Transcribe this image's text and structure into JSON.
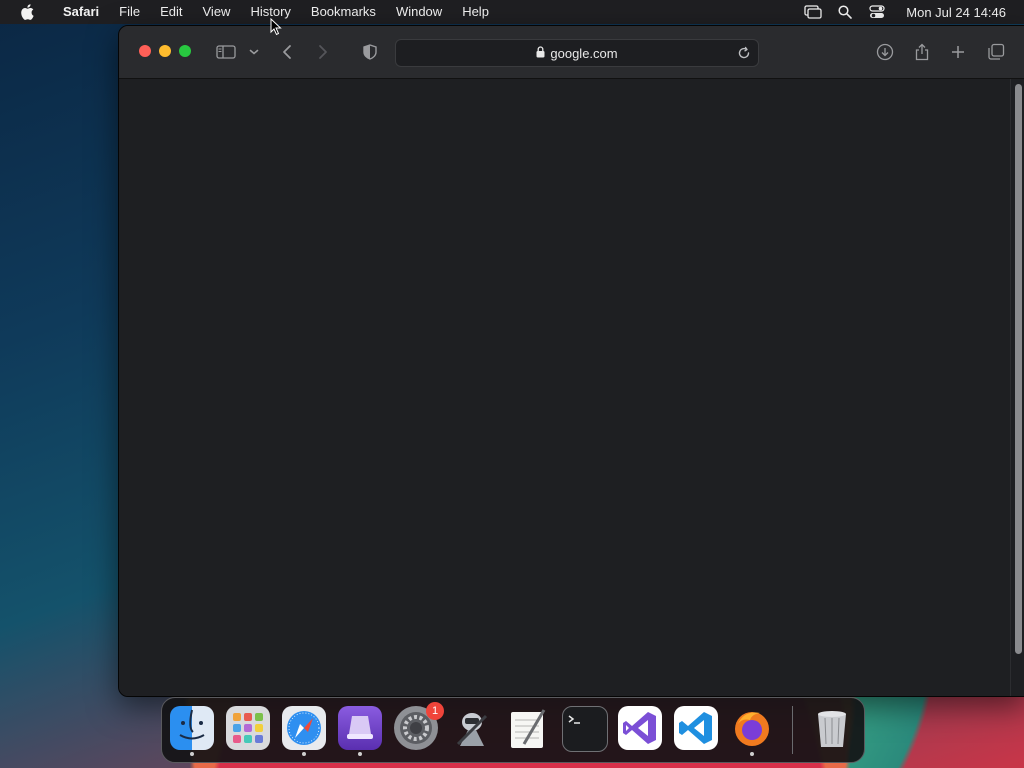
{
  "menubar": {
    "app_name": "Safari",
    "items": [
      "File",
      "Edit",
      "View",
      "History",
      "Bookmarks",
      "Window",
      "Help"
    ],
    "clock": "Mon Jul 24  14:46",
    "status_icons": [
      "screen-mirroring-icon",
      "spotlight-search-icon",
      "control-center-icon"
    ]
  },
  "browser": {
    "url": "google.com",
    "toolbar_icons": [
      "sidebar-icon",
      "chevron-down-icon",
      "back-icon",
      "forward-icon",
      "privacy-shield-icon",
      "lock-icon",
      "reload-icon",
      "download-icon",
      "share-icon",
      "new-tab-icon",
      "tab-overview-icon"
    ]
  },
  "dock": {
    "apps": [
      {
        "name": "Finder",
        "running": true
      },
      {
        "name": "Launchpad",
        "running": false
      },
      {
        "name": "Safari",
        "running": true
      },
      {
        "name": "Simulator",
        "running": true
      },
      {
        "name": "System Settings",
        "running": false,
        "badge": "1"
      },
      {
        "name": "Automator",
        "running": false
      },
      {
        "name": "TextEdit",
        "running": false
      },
      {
        "name": "Terminal",
        "running": false
      },
      {
        "name": "Visual Studio",
        "running": false
      },
      {
        "name": "Visual Studio Code",
        "running": false
      },
      {
        "name": "Firefox",
        "running": true
      },
      {
        "name": "Trash",
        "running": false
      }
    ]
  },
  "colors": {
    "close": "#fe5f57",
    "minimize": "#febc2e",
    "maximize": "#28c840",
    "window_bg": "#1e1f22",
    "badge": "#f0443a"
  }
}
